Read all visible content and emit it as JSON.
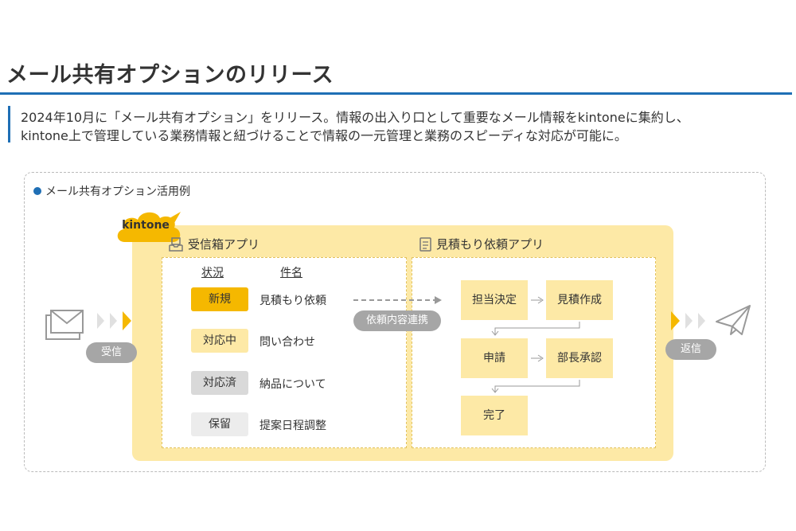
{
  "page": {
    "title": "メール共有オプションのリリース",
    "description": [
      "2024年10月に「メール共有オプション」をリリース。情報の出入り口として重要なメール情報をkintoneに集約し、",
      "kintone上で管理している業務情報と紐づけることで情報の一元管理と業務のスピーディな対応が可能に。"
    ]
  },
  "diagram": {
    "heading": "メール共有オプション活用例",
    "platform_label": "kintone",
    "receive_label": "受信",
    "reply_label": "返信",
    "link_label": "依頼内容連携",
    "inbox_app": {
      "title": "受信箱アプリ",
      "column_status": "状況",
      "column_subject": "件名",
      "rows": [
        {
          "status": "新規",
          "subject": "見積もり依頼",
          "color": "#f5b800"
        },
        {
          "status": "対応中",
          "subject": "問い合わせ",
          "color": "#fde9a6"
        },
        {
          "status": "対応済",
          "subject": "納品について",
          "color": "#d9d9d9"
        },
        {
          "status": "保留",
          "subject": "提案日程調整",
          "color": "#ececec"
        }
      ]
    },
    "quote_app": {
      "title": "見積もり依頼アプリ",
      "steps": [
        "担当決定",
        "見積作成",
        "申請",
        "部長承認",
        "完了"
      ]
    },
    "colors": {
      "accent": "#1f6fb5",
      "kintone_panel": "#fde9a6",
      "kintone_cloud": "#f5b800",
      "arrow_gold": "#f5b800",
      "arrow_light": "#e0e0e0",
      "gray_pill": "#a6a6a6"
    },
    "icons": [
      "mail-icon",
      "paper-plane-icon",
      "inbox-tray-icon",
      "document-icon"
    ]
  }
}
